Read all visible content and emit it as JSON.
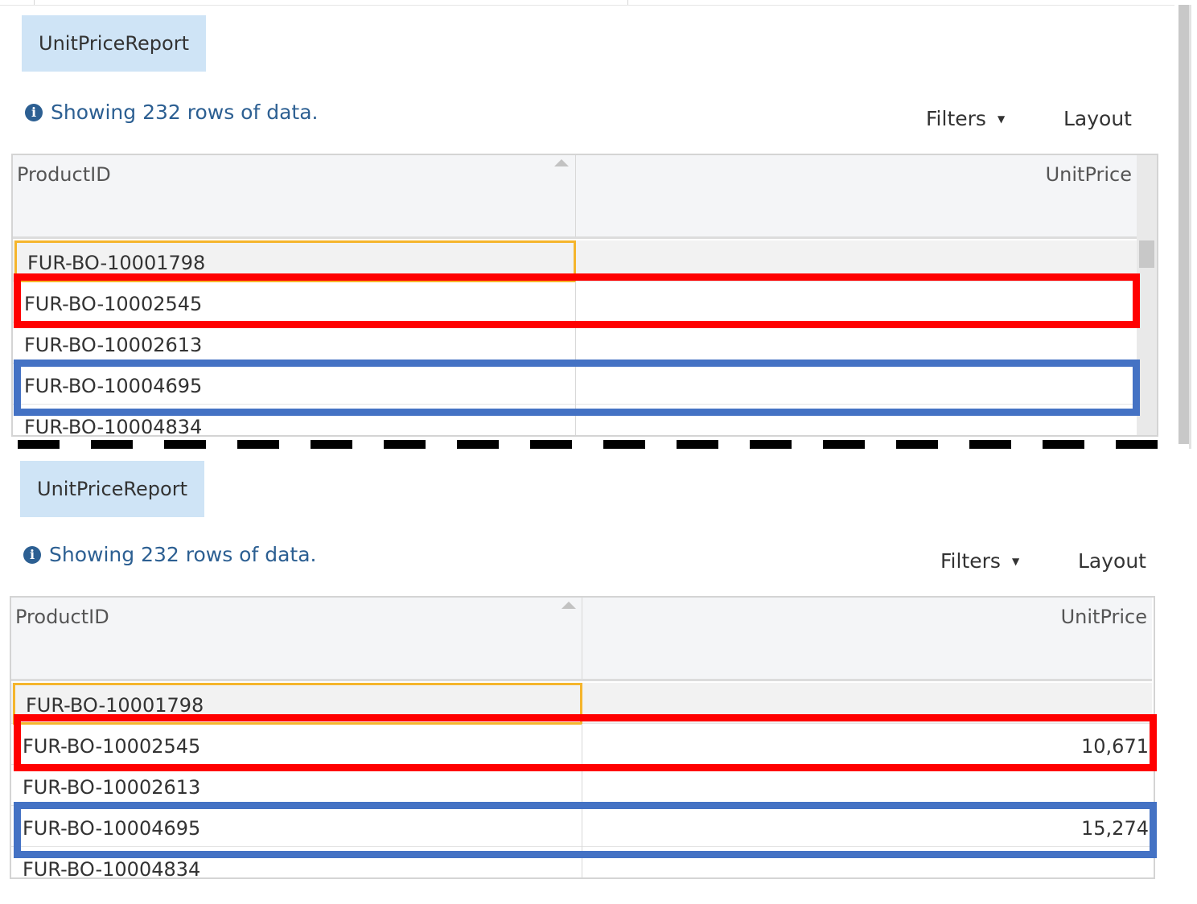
{
  "panels": [
    {
      "report_tab": "UnitPriceReport",
      "info_text": "Showing 232 rows of data.",
      "filters_label": "Filters",
      "layout_label": "Layout",
      "columns": [
        "ProductID",
        "UnitPrice"
      ],
      "rows": [
        {
          "product_id": "FUR-BO-10001798",
          "unit_price": ""
        },
        {
          "product_id": "FUR-BO-10002545",
          "unit_price": ""
        },
        {
          "product_id": "FUR-BO-10002613",
          "unit_price": ""
        },
        {
          "product_id": "FUR-BO-10004695",
          "unit_price": ""
        },
        {
          "product_id": "FUR-BO-10004834",
          "unit_price": ""
        }
      ]
    },
    {
      "report_tab": "UnitPriceReport",
      "info_text": "Showing 232 rows of data.",
      "filters_label": "Filters",
      "layout_label": "Layout",
      "columns": [
        "ProductID",
        "UnitPrice"
      ],
      "rows": [
        {
          "product_id": "FUR-BO-10001798",
          "unit_price": ""
        },
        {
          "product_id": "FUR-BO-10002545",
          "unit_price": "10,671"
        },
        {
          "product_id": "FUR-BO-10002613",
          "unit_price": ""
        },
        {
          "product_id": "FUR-BO-10004695",
          "unit_price": "15,274"
        },
        {
          "product_id": "FUR-BO-10004834",
          "unit_price": ""
        }
      ]
    }
  ],
  "icons": {
    "info": "info-circle-icon",
    "filters_caret": "caret-down-icon",
    "sort": "sort-ascending-icon"
  },
  "colors": {
    "tab_bg": "#cfe4f6",
    "info_text": "#2c5f92",
    "highlight_red": "#ff0000",
    "highlight_blue": "#4472c4",
    "focus_cell": "#f5b52c"
  }
}
